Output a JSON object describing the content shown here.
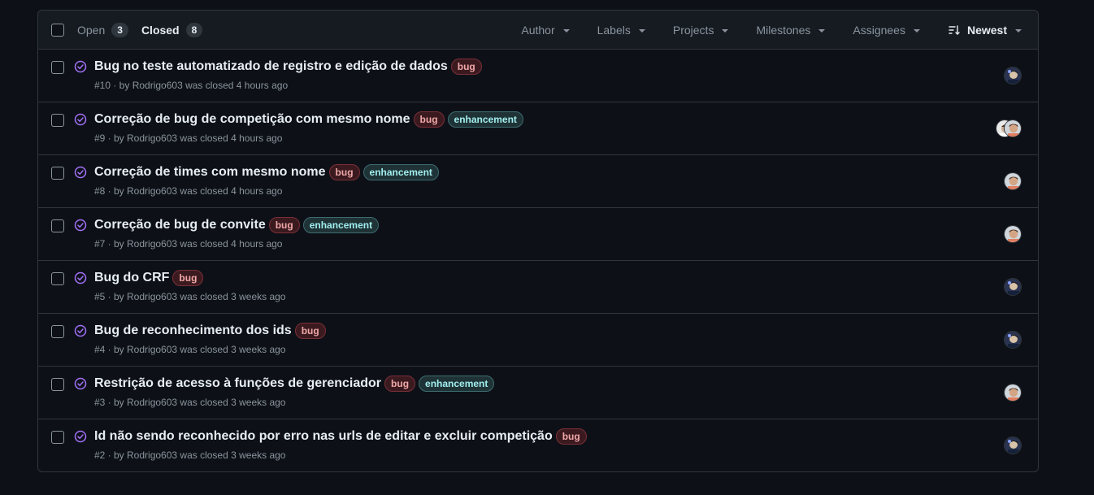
{
  "header": {
    "open_label": "Open",
    "open_count": "3",
    "closed_label": "Closed",
    "closed_count": "8",
    "filters": [
      "Author",
      "Labels",
      "Projects",
      "Milestones",
      "Assignees"
    ],
    "sort_label": "Newest"
  },
  "colors": {
    "closed_icon": "#a371f7",
    "bug_label": "#f0a8a8",
    "enhancement_label": "#a2eeef"
  },
  "issues": [
    {
      "title": "Bug no teste automatizado de registro e edição de dados",
      "labels": [
        "bug"
      ],
      "meta": "#10 · by Rodrigo603 was closed 4 hours ago",
      "avatars": [
        "avatar-dark"
      ]
    },
    {
      "title": "Correção de bug de competição com mesmo nome",
      "labels": [
        "bug",
        "enhancement"
      ],
      "meta": "#9 · by Rodrigo603 was closed 4 hours ago",
      "avatars": [
        "avatar-light",
        "avatar-face"
      ]
    },
    {
      "title": "Correção de times com mesmo nome",
      "labels": [
        "bug",
        "enhancement"
      ],
      "meta": "#8 · by Rodrigo603 was closed 4 hours ago",
      "avatars": [
        "avatar-face"
      ]
    },
    {
      "title": "Correção de bug de convite",
      "labels": [
        "bug",
        "enhancement"
      ],
      "meta": "#7 · by Rodrigo603 was closed 4 hours ago",
      "avatars": [
        "avatar-face"
      ]
    },
    {
      "title": "Bug do CRF",
      "labels": [
        "bug"
      ],
      "meta": "#5 · by Rodrigo603 was closed 3 weeks ago",
      "avatars": [
        "avatar-dark"
      ]
    },
    {
      "title": "Bug de reconhecimento dos ids",
      "labels": [
        "bug"
      ],
      "meta": "#4 · by Rodrigo603 was closed 3 weeks ago",
      "avatars": [
        "avatar-dark"
      ]
    },
    {
      "title": "Restrição de acesso à funções de gerenciador",
      "labels": [
        "bug",
        "enhancement"
      ],
      "meta": "#3 · by Rodrigo603 was closed 3 weeks ago",
      "avatars": [
        "avatar-face"
      ]
    },
    {
      "title": "Id não sendo reconhecido por erro nas urls de editar e excluir competição",
      "labels": [
        "bug"
      ],
      "meta": "#2 · by Rodrigo603 was closed 3 weeks ago",
      "avatars": [
        "avatar-dark"
      ]
    }
  ]
}
